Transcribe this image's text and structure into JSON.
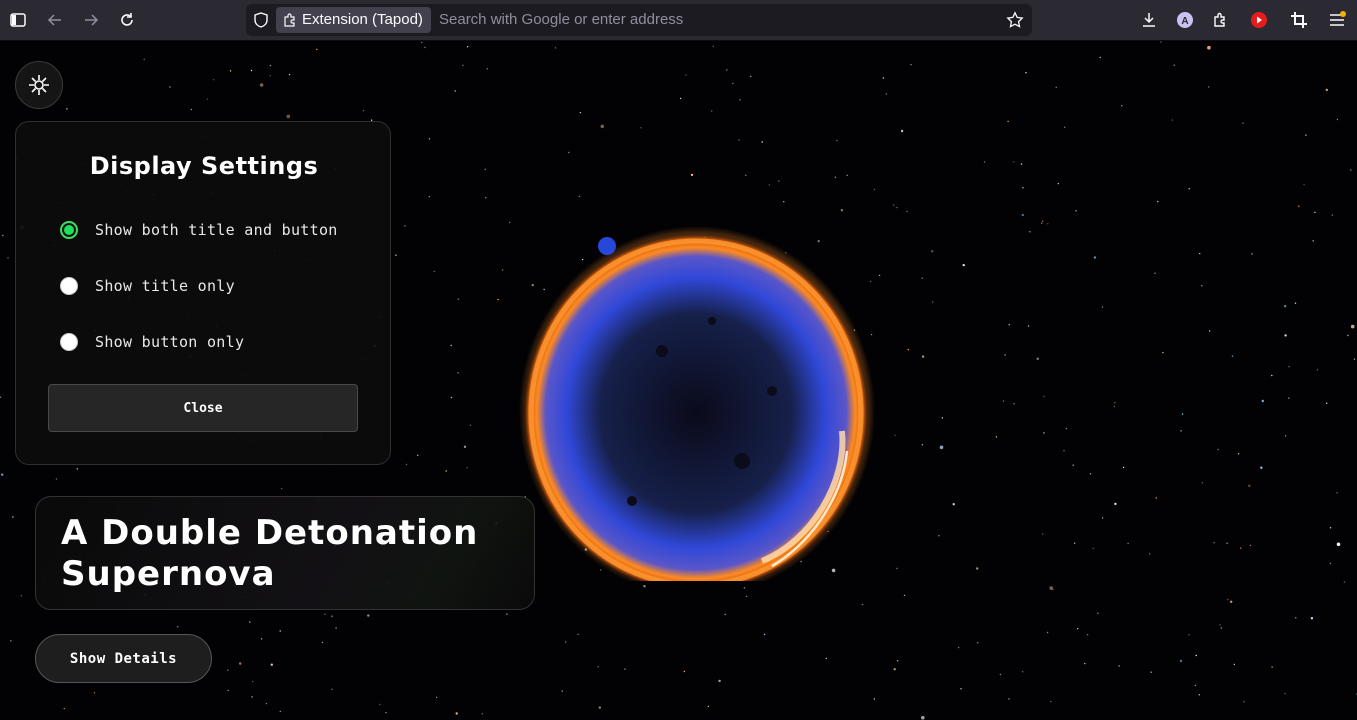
{
  "browser": {
    "extension_chip_label": "Extension (Tapod)",
    "address_placeholder": "Search with Google or enter address",
    "icons": [
      "sidebar-icon",
      "back-icon",
      "forward-icon",
      "reload-icon",
      "shield-icon",
      "puzzle-icon",
      "bookmark-star-icon",
      "download-icon",
      "account-icon",
      "extensions-icon",
      "youtube-icon",
      "crop-icon",
      "menu-icon"
    ],
    "account_initial": "A"
  },
  "settings_panel": {
    "toggle_icon": "sparkle-icon",
    "title": "Display Settings",
    "options": [
      {
        "label": "Show both title and button",
        "checked": true
      },
      {
        "label": "Show title only",
        "checked": false
      },
      {
        "label": "Show button only",
        "checked": false
      }
    ],
    "close_label": "Close"
  },
  "card": {
    "title": "A Double Detonation Supernova"
  },
  "details_button_label": "Show Details",
  "colors": {
    "accent_green": "#1fe05a",
    "toolbar_bg": "#2b2a33",
    "urlbar_bg": "#1c1b22",
    "nebula_orange": "#ff8a1f",
    "nebula_blue": "#3a5cff"
  }
}
